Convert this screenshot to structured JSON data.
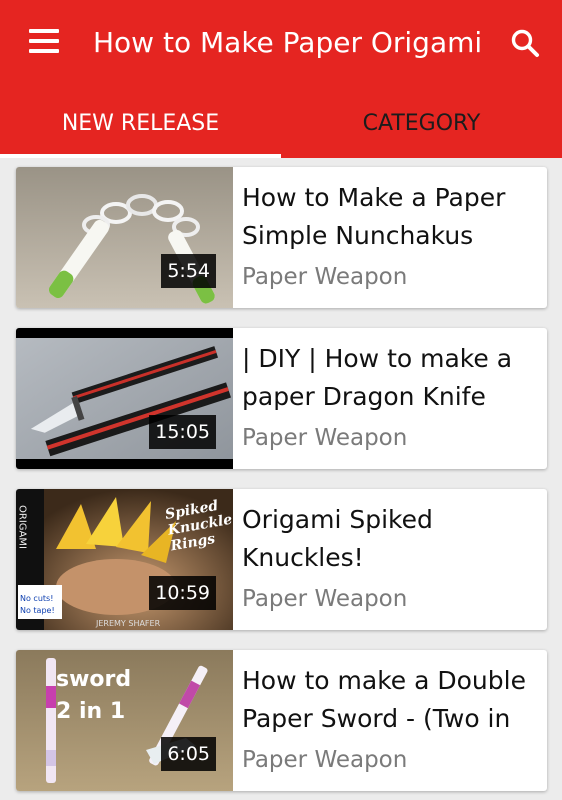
{
  "appbar": {
    "title": "How to Make Paper Origami",
    "menu_icon": "hamburger-menu-icon",
    "search_icon": "search-icon",
    "color": "#e52521"
  },
  "tabs": [
    {
      "label": "NEW RELEASE",
      "active": true
    },
    {
      "label": "CATEGORY",
      "active": false
    }
  ],
  "videos": [
    {
      "title": "How to Make a Paper Simple Nunchakus",
      "category": "Paper Weapon",
      "duration": "5:54"
    },
    {
      "title": "| DIY | How to make a paper Dragon Knife",
      "category": "Paper Weapon",
      "duration": "15:05"
    },
    {
      "title": "Origami Spiked Knuckles!",
      "category": "Paper Weapon",
      "duration": "10:59",
      "thumbnail_text": {
        "side": "ORIGAMI",
        "main": "Spiked Knuckle Rings",
        "badge": "No cuts! No tape!",
        "credit": "JEREMY SHAFER"
      }
    },
    {
      "title": "How to make a Double Paper Sword - (Two in",
      "category": "Paper Weapon",
      "duration": "6:05",
      "thumbnail_text": {
        "overlay": "sword 2 in 1"
      }
    }
  ]
}
